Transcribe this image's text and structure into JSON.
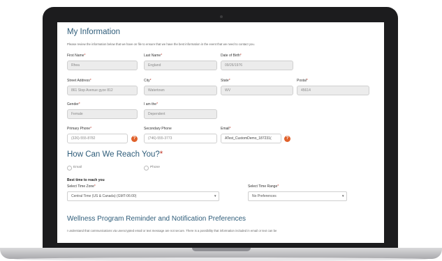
{
  "my_info": {
    "title": "My Information",
    "intro": "Please review the information below that we have on file to ensure that we have the best information in the event that we need to contact you.",
    "first_name": {
      "label": "First Name",
      "value": "Rhea"
    },
    "last_name": {
      "label": "Last Name",
      "value": "England"
    },
    "dob": {
      "label": "Date of Birth",
      "value": "09/26/1976"
    },
    "street": {
      "label": "Street Address",
      "value": "861 Stop Avenue gyze 812"
    },
    "city": {
      "label": "City",
      "value": "Watertown"
    },
    "state": {
      "label": "State",
      "value": "WV"
    },
    "postal": {
      "label": "Postal",
      "value": "45614"
    },
    "gender": {
      "label": "Gender",
      "value": "Female"
    },
    "i_am_the": {
      "label": "I am the",
      "value": "Dependent"
    },
    "primary_phone": {
      "label": "Primary Phone",
      "value": "(326)-555-8782"
    },
    "secondary_phone": {
      "label": "Secondary Phone",
      "value": "(746)-555-3773"
    },
    "email": {
      "label": "Email",
      "value": "ATest_CustomDemo_187231("
    },
    "required_mark": "*",
    "info_icon_glyph": "?"
  },
  "reach": {
    "title": "How Can We Reach You?",
    "required_mark": "*",
    "options": [
      "Email",
      "Phone"
    ],
    "best_time_label": "Best time to reach you",
    "timezone_label": "Select Time Zone",
    "timezone_value": "Central Time (US & Canada) (GMT-06:00)",
    "timerange_label": "Select Time Range",
    "timerange_value": "No Preferences"
  },
  "wellness": {
    "title": "Wellness Program Reminder and Notification Preferences",
    "text": "I understand that communications via unencrypted email or text message are not secure. There is a possibility that information included in email or text can be"
  },
  "colors": {
    "heading": "#2f5d7a",
    "info_icon": "#e0612b",
    "required": "#c0392b"
  }
}
